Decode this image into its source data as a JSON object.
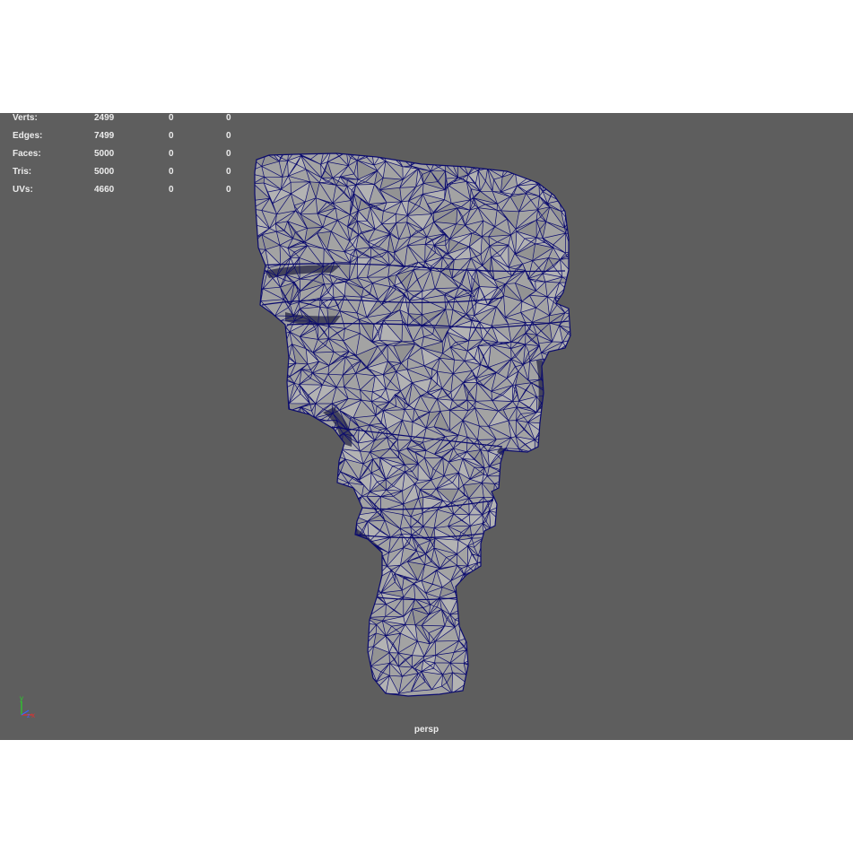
{
  "hud": {
    "rows": [
      {
        "label": "Verts:",
        "values": [
          "2499",
          "0",
          "0"
        ]
      },
      {
        "label": "Edges:",
        "values": [
          "7499",
          "0",
          "0"
        ]
      },
      {
        "label": "Faces:",
        "values": [
          "5000",
          "0",
          "0"
        ]
      },
      {
        "label": "Tris:",
        "values": [
          "5000",
          "0",
          "0"
        ]
      },
      {
        "label": "UVs:",
        "values": [
          "4660",
          "0",
          "0"
        ]
      }
    ]
  },
  "viewport": {
    "camera": "persp",
    "background_color": "#5e5e5e",
    "mesh_fill_color": "#a3a3a3",
    "wireframe_color": "#0b0b6e",
    "axis": {
      "y_label": "y",
      "x_label": "x",
      "z_label": "z",
      "y_color": "#27d427",
      "x_color": "#e23030",
      "z_color": "#3a63ff"
    }
  }
}
